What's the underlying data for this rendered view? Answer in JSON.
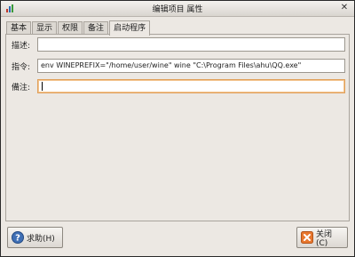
{
  "window": {
    "title": "编辑项目 属性"
  },
  "tabs": [
    {
      "label": "基本",
      "active": false
    },
    {
      "label": "显示",
      "active": false
    },
    {
      "label": "权限",
      "active": false
    },
    {
      "label": "备注",
      "active": false
    },
    {
      "label": "启动程序",
      "active": true
    }
  ],
  "form": {
    "description": {
      "label": "描述:",
      "value": ""
    },
    "command": {
      "label": "指令:",
      "value": "env WINEPREFIX=\"/home/user/wine\" wine \"C:\\Program Files\\ahu\\QQ.exe\""
    },
    "comment": {
      "label": "備注:",
      "value": ""
    }
  },
  "buttons": {
    "help_label": "求助(H)",
    "close_label": "关闭(C)"
  },
  "colors": {
    "window_bg": "#ece8e3",
    "focus_border": "#e0a05a",
    "help_icon": "#3f6fb5",
    "close_icon": "#e8772e"
  },
  "icons": {
    "help": "question-mark-circle",
    "close": "x-square",
    "window": "app-icon",
    "title_close": "x-mark"
  }
}
